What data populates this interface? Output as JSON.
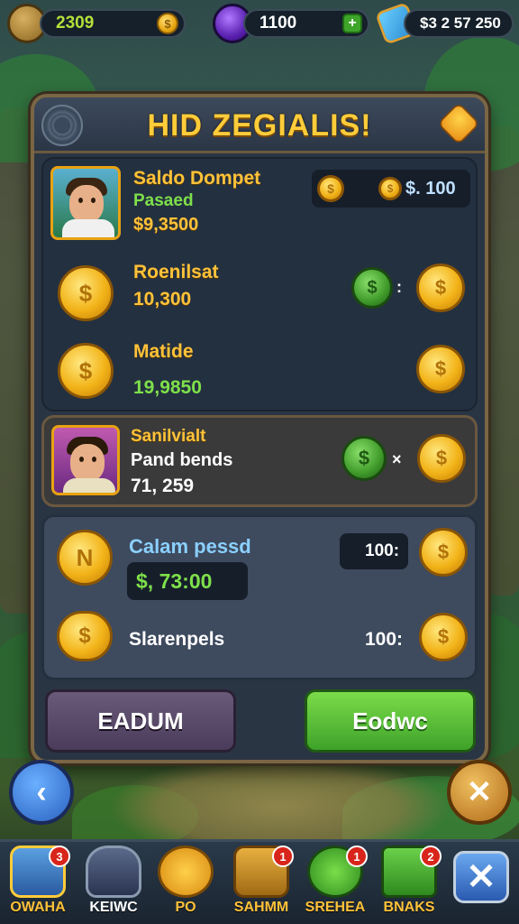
{
  "top_bar": {
    "gold_value": "2309",
    "gem_value": "1100",
    "cash_value": "$3 2 57 250"
  },
  "dialog": {
    "title": "HID ZEGIALIS!",
    "rows": [
      {
        "name": "Saldo Dompet",
        "sub": "Pasaed",
        "value": "$9,3500",
        "box_value": "$. 100"
      },
      {
        "name": "Roenilsat",
        "value": "10,300"
      },
      {
        "name": "Matide",
        "value": "19,9850"
      }
    ],
    "highlight_row": {
      "name": "Sanilvialt",
      "sub": "Pand bends",
      "value": "71, 259"
    },
    "currency_row": {
      "name": "Calam pessd",
      "value": "$, 73:00",
      "box_value": "100:"
    },
    "stack_row": {
      "name": "Slarenpels",
      "value": "100:"
    },
    "buttons": {
      "left": "EADUM",
      "right": "Eodwc"
    }
  },
  "bottom_nav": [
    {
      "label": "OWAHA",
      "badge": "3"
    },
    {
      "label": "KEIWC",
      "badge": ""
    },
    {
      "label": "PO",
      "badge": ""
    },
    {
      "label": "SAHMM",
      "badge": "1"
    },
    {
      "label": "SREHEA",
      "badge": "1"
    },
    {
      "label": "BNAKS",
      "badge": "2"
    }
  ],
  "colors": {
    "accent_gold": "#ffc23a",
    "positive_green": "#7ee04a",
    "panel_bg": "#2a3544",
    "border_brown": "#7a6644"
  },
  "icons": [
    "gold-coin-icon",
    "purple-gem-icon",
    "plus-icon",
    "cash-icon",
    "back-arrow-icon",
    "close-x-icon"
  ]
}
